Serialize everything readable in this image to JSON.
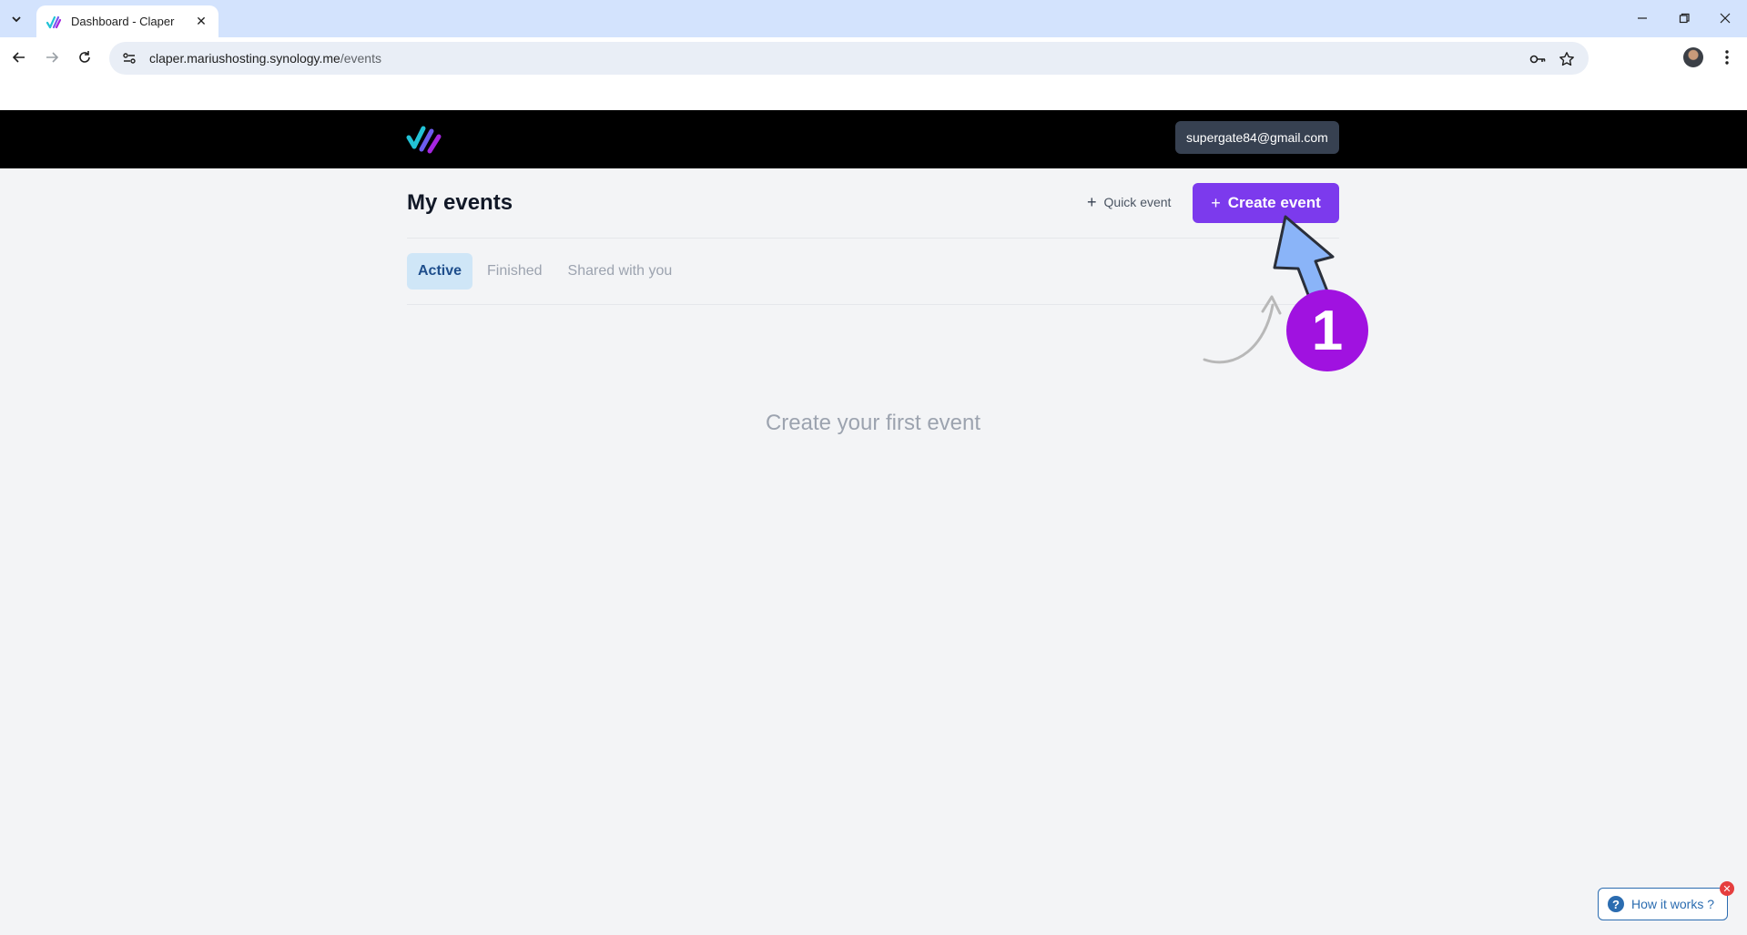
{
  "browser": {
    "tab_title": "Dashboard - Claper",
    "url_host": "claper.mariushosting.synology.me",
    "url_path": "/events"
  },
  "header": {
    "user_email": "supergate84@gmail.com"
  },
  "main": {
    "title": "My events",
    "quick_event_label": "Quick event",
    "create_event_label": "Create event",
    "tabs": [
      {
        "label": "Active",
        "active": true
      },
      {
        "label": "Finished",
        "active": false
      },
      {
        "label": "Shared with you",
        "active": false
      }
    ],
    "empty_message": "Create your first event"
  },
  "annotation": {
    "step_number": "1"
  },
  "help_widget": {
    "label": "How it works ?"
  },
  "colors": {
    "accent": "#7c3aed",
    "active_tab_bg": "#cfe6f7",
    "annotation_badge": "#a012e0",
    "annotation_arrow": "#8ab4f8"
  }
}
